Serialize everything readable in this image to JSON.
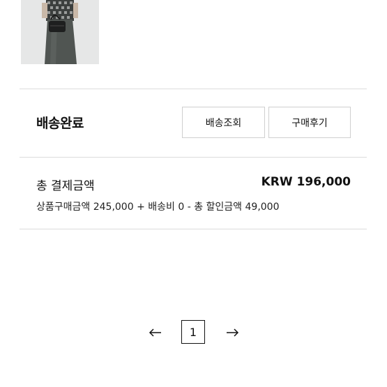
{
  "order": {
    "status_title": "배송완료",
    "buttons": {
      "tracking_label": "배송조회",
      "review_label": "구매후기"
    }
  },
  "payment": {
    "total_label": "총 결제금액",
    "total_amount": "KRW 196,000",
    "breakdown": "상품구매금액 245,000 + 배송비 0 - 총 할인금액 49,000"
  },
  "pagination": {
    "current_page": "1",
    "prev_icon": "arrow-left-icon",
    "next_icon": "arrow-right-icon"
  },
  "colors": {
    "divider": "#dcdcdc",
    "button_border": "#cfcfcf",
    "text": "#111111"
  }
}
